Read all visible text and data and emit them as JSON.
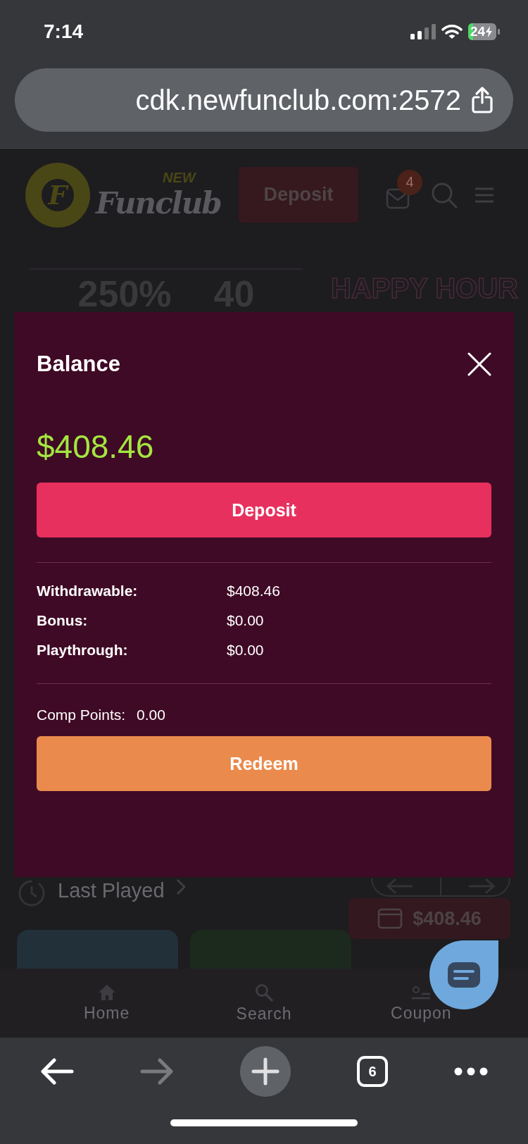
{
  "status_bar": {
    "time": "7:14",
    "battery": "24"
  },
  "browser": {
    "url": "cdk.newfunclub.com:2572",
    "forward_disabled": true,
    "tab_count": "6"
  },
  "site_header": {
    "logo_letter": "F",
    "logo_badge": "NEW",
    "logo_text": "Funclub",
    "deposit_button": "Deposit",
    "mail_badge": "4"
  },
  "banners": [
    {
      "kind": "promo",
      "texts": [
        "250%",
        "40"
      ]
    },
    {
      "kind": "neon",
      "texts": [
        "HAPPY HOUR"
      ]
    }
  ],
  "modal": {
    "title": "Balance",
    "balance": "$408.46",
    "deposit_button": "Deposit",
    "rows": [
      {
        "label": "Withdrawable:",
        "value": "$408.46"
      },
      {
        "label": "Bonus:",
        "value": "$0.00"
      },
      {
        "label": "Playthrough:",
        "value": "$0.00"
      }
    ],
    "comp_points": {
      "label": "Comp Points:",
      "value": "0.00"
    },
    "redeem_button": "Redeem"
  },
  "last_played": {
    "title": "Last Played"
  },
  "floating_balance": "$408.46",
  "bottom_nav": [
    {
      "kind": "home",
      "label": "Home"
    },
    {
      "kind": "search",
      "label": "Search"
    },
    {
      "kind": "coupon",
      "label": "Coupon"
    }
  ]
}
